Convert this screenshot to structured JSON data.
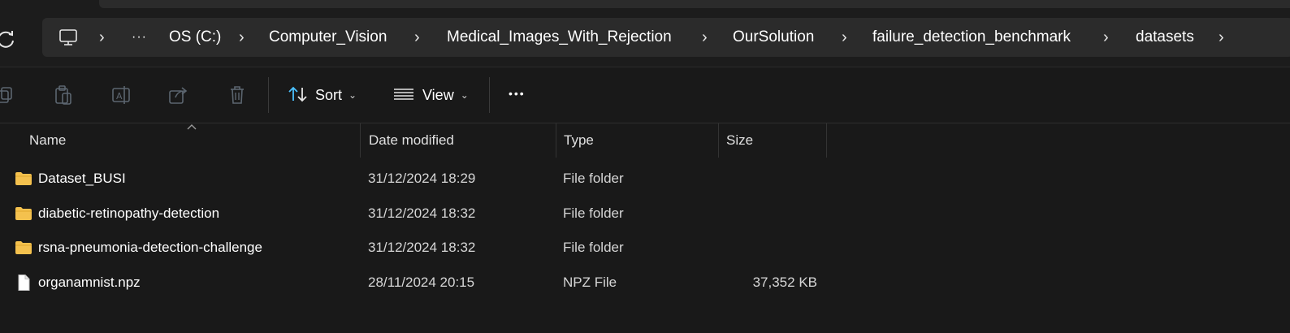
{
  "breadcrumb": {
    "items": [
      "OS (C:)",
      "Computer_Vision",
      "Medical_Images_With_Rejection",
      "OurSolution",
      "failure_detection_benchmark",
      "datasets"
    ],
    "overflow_label": "···"
  },
  "toolbar": {
    "sort_label": "Sort",
    "view_label": "View",
    "more_label": "•••"
  },
  "columns": {
    "name": "Name",
    "date": "Date modified",
    "type": "Type",
    "size": "Size"
  },
  "files": [
    {
      "name": "Dataset_BUSI",
      "date": "31/12/2024 18:29",
      "type": "File folder",
      "size": "",
      "icon": "folder-icon"
    },
    {
      "name": "diabetic-retinopathy-detection",
      "date": "31/12/2024 18:32",
      "type": "File folder",
      "size": "",
      "icon": "folder-icon"
    },
    {
      "name": "rsna-pneumonia-detection-challenge",
      "date": "31/12/2024 18:32",
      "type": "File folder",
      "size": "",
      "icon": "folder-icon"
    },
    {
      "name": "organamnist.npz",
      "date": "28/11/2024 20:15",
      "type": "NPZ File",
      "size": "37,352 KB",
      "icon": "file-icon"
    }
  ],
  "colors": {
    "background": "#191919",
    "address_bar": "#2b2b2b",
    "folder": "#f4c14e",
    "accent": "#4cc2ff"
  }
}
